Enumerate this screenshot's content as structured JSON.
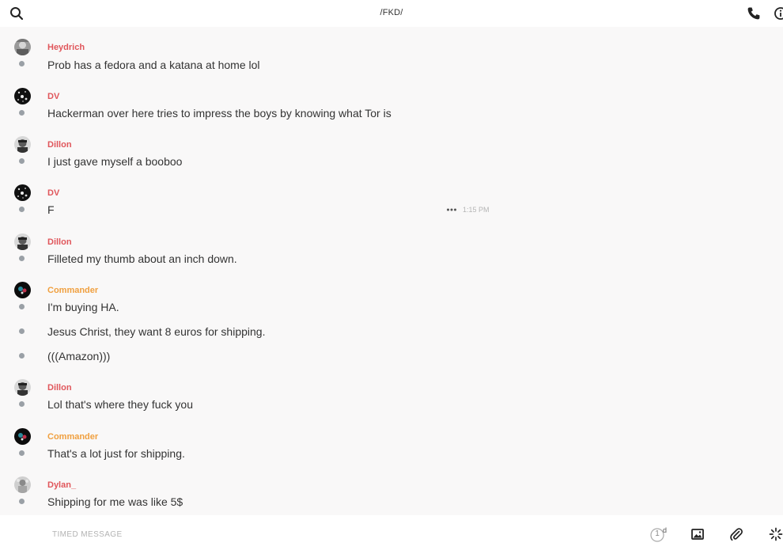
{
  "header": {
    "title": "/FKD/"
  },
  "messages": [
    {
      "author": "Heydrich",
      "text": "Prob has a fedora and a katana at home lol"
    },
    {
      "author": "DV",
      "text": "Hackerman over here tries to impress the boys by knowing what Tor is"
    },
    {
      "author": "Dillon",
      "text": "I just gave myself a booboo"
    },
    {
      "author": "DV",
      "text": "F",
      "time": "1:15 PM"
    },
    {
      "author": "Dillon",
      "text": "Filleted my thumb about an inch down."
    },
    {
      "author": "Commander",
      "text": "I'm buying HA."
    },
    {
      "text": "Jesus Christ, they want 8 euros for shipping."
    },
    {
      "text": "(((Amazon)))"
    },
    {
      "author": "Dillon",
      "text": "Lol that's where they fuck you"
    },
    {
      "author": "Commander",
      "text": "That's a lot just for shipping."
    },
    {
      "author": "Dylan_",
      "text": "Shipping for me was like 5$"
    }
  ],
  "composer": {
    "placeholder": "TIMED MESSAGE",
    "timer_value": "1",
    "timer_unit": "d"
  },
  "colors": {
    "author_red": "#e0565b",
    "author_orange": "#f0a040",
    "background": "#f9f8f8",
    "dot": "#9aa0a6"
  },
  "icons": {
    "search": "search-icon",
    "phone": "phone-icon",
    "info": "info-icon",
    "more": "more-icon",
    "timer": "timer-icon",
    "image": "image-icon",
    "attach": "paperclip-icon",
    "spinner": "spinner-icon"
  }
}
